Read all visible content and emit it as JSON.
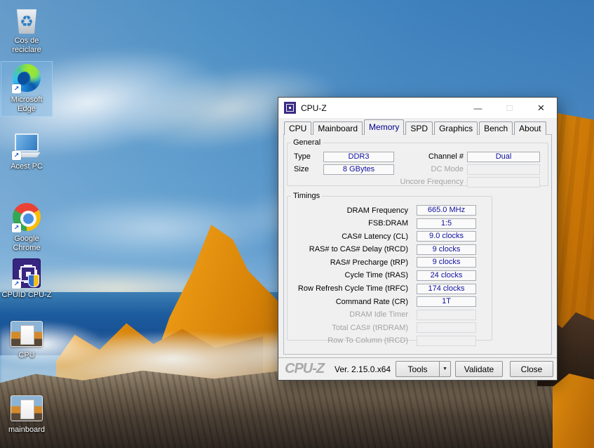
{
  "desktop": {
    "icons": [
      {
        "name": "desktop-icon-recycle-bin",
        "icon": "recycle-bin",
        "label": "Coș de reciclare"
      },
      {
        "name": "desktop-icon-microsoft-edge",
        "icon": "edge",
        "label": "Microsoft Edge",
        "selected": true,
        "shortcut": true
      },
      {
        "name": "desktop-icon-this-pc",
        "icon": "this-pc",
        "label": "Acest PC",
        "shortcut": true
      },
      {
        "name": "desktop-icon-google-chrome",
        "icon": "chrome",
        "label": "Google Chrome",
        "shortcut": true
      },
      {
        "name": "desktop-icon-cpuid-cpuz",
        "icon": "cpuz",
        "label": "CPUID CPU-Z",
        "shortcut": true
      },
      {
        "name": "desktop-icon-cpu-image",
        "icon": "photo",
        "label": "CPU"
      },
      {
        "name": "desktop-icon-mainboard-image",
        "icon": "photo",
        "label": "mainboard"
      }
    ]
  },
  "window": {
    "title": "CPU-Z",
    "controls": {
      "minimize": "—",
      "maximize": "□",
      "close": "×"
    },
    "tabs": [
      {
        "name": "tab-cpu",
        "label": "CPU"
      },
      {
        "name": "tab-mainboard",
        "label": "Mainboard"
      },
      {
        "name": "tab-memory",
        "label": "Memory",
        "active": true
      },
      {
        "name": "tab-spd",
        "label": "SPD"
      },
      {
        "name": "tab-graphics",
        "label": "Graphics"
      },
      {
        "name": "tab-bench",
        "label": "Bench"
      },
      {
        "name": "tab-about",
        "label": "About"
      }
    ],
    "general": {
      "legend": "General",
      "left": [
        {
          "label": "Type",
          "value": "DDR3"
        },
        {
          "label": "Size",
          "value": "8 GBytes"
        }
      ],
      "right": [
        {
          "label": "Channel #",
          "value": "Dual"
        },
        {
          "label": "DC Mode",
          "value": "",
          "disabled": true
        },
        {
          "label": "Uncore Frequency",
          "value": "",
          "disabled": true
        }
      ]
    },
    "timings": {
      "legend": "Timings",
      "rows": [
        {
          "label": "DRAM Frequency",
          "value": "665.0 MHz"
        },
        {
          "label": "FSB:DRAM",
          "value": "1:5"
        },
        {
          "label": "CAS# Latency (CL)",
          "value": "9.0 clocks"
        },
        {
          "label": "RAS# to CAS# Delay (tRCD)",
          "value": "9 clocks"
        },
        {
          "label": "RAS# Precharge (tRP)",
          "value": "9 clocks"
        },
        {
          "label": "Cycle Time (tRAS)",
          "value": "24 clocks"
        },
        {
          "label": "Row Refresh Cycle Time (tRFC)",
          "value": "174 clocks"
        },
        {
          "label": "Command Rate (CR)",
          "value": "1T"
        },
        {
          "label": "DRAM Idle Timer",
          "value": "",
          "disabled": true
        },
        {
          "label": "Total CAS# (tRDRAM)",
          "value": "",
          "disabled": true
        },
        {
          "label": "Row To Column (tRCD)",
          "value": "",
          "disabled": true
        }
      ]
    },
    "statusbar": {
      "logo": "CPU-Z",
      "version": "Ver. 2.15.0.x64",
      "tools": "Tools",
      "dropdown_arrow": "▼",
      "validate": "Validate",
      "close": "Close"
    }
  },
  "colors": {
    "dialog_bg": "#f0f0f0",
    "titlebar_bg": "#ffffff",
    "value_text_navy": "#0f0f9e",
    "active_tab_text": "#00008c",
    "rock_orange": "#e9940f",
    "sky_blue": "#4488c4"
  }
}
